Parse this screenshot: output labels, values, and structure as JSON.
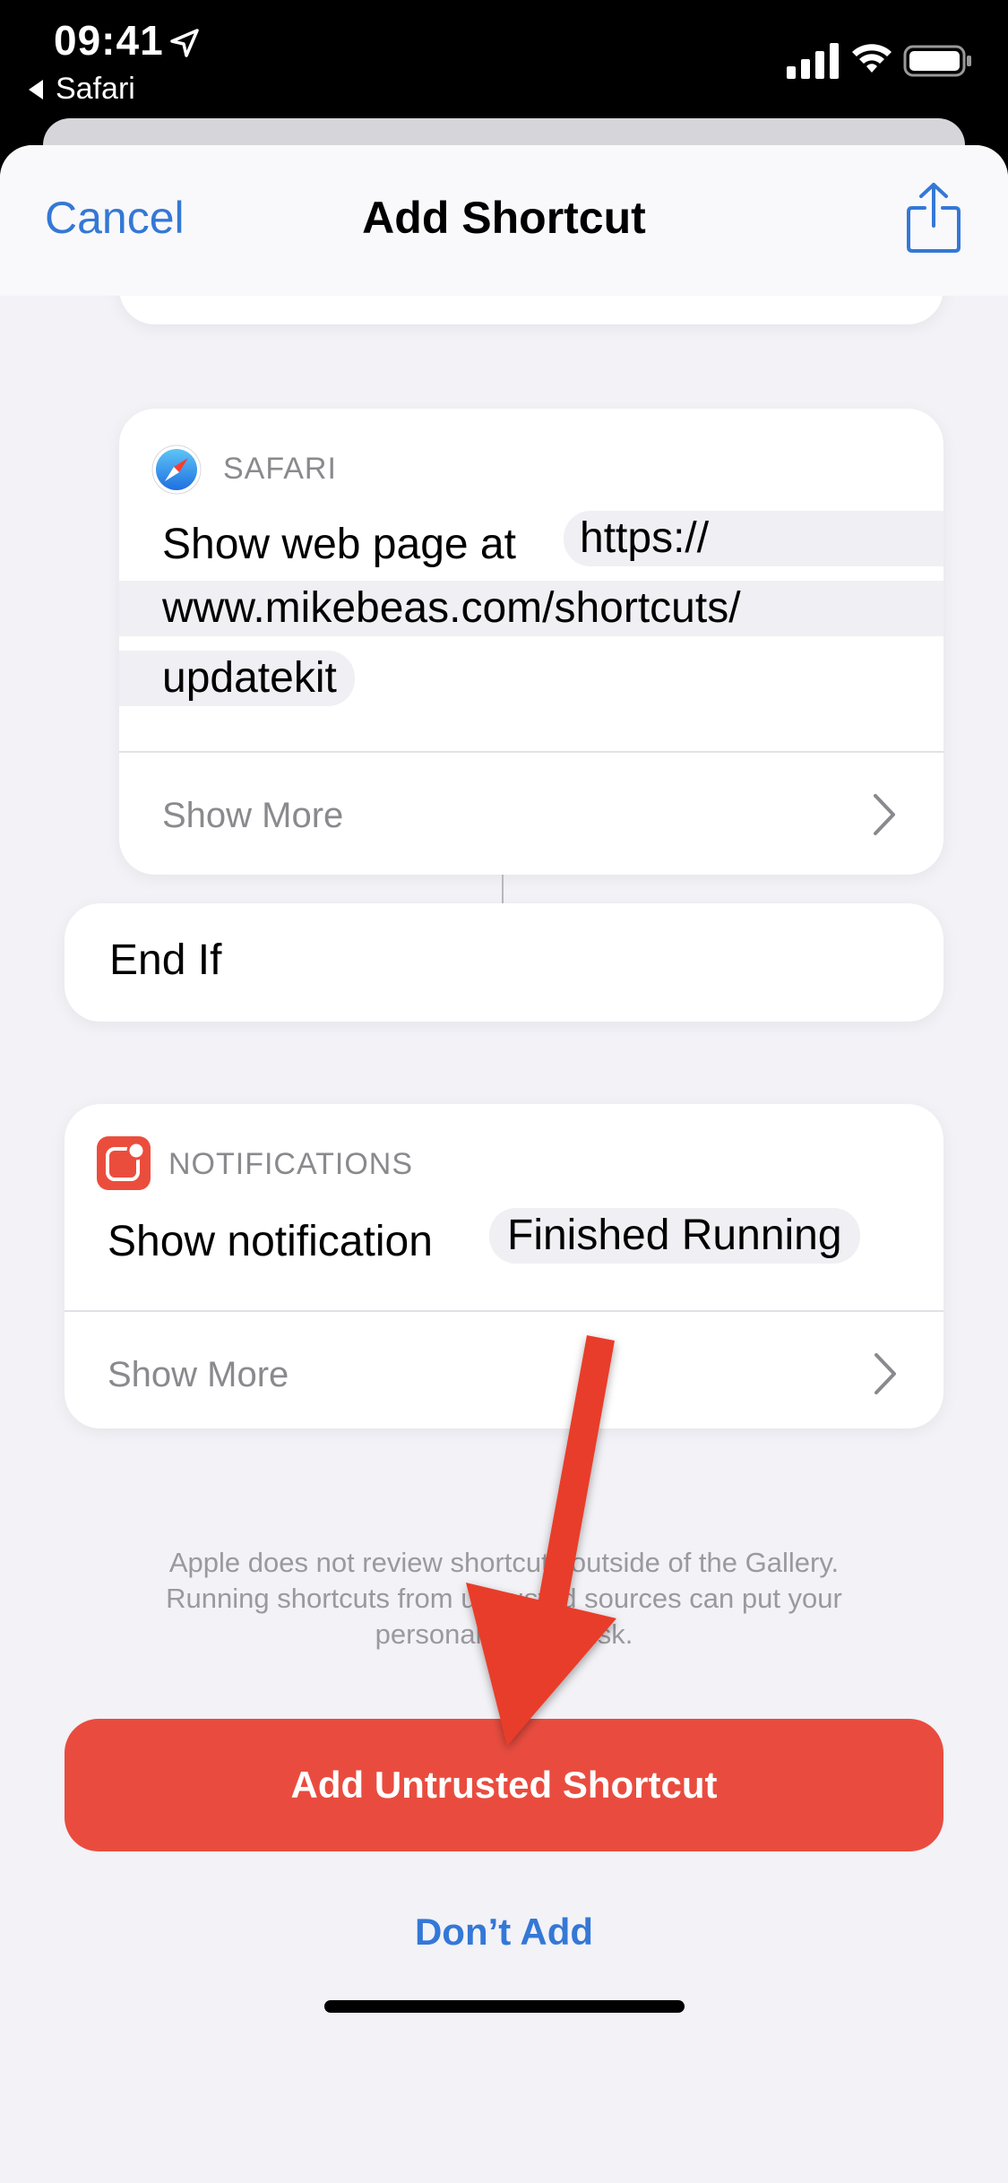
{
  "status_bar": {
    "time": "09:41",
    "back_app": "Safari"
  },
  "navbar": {
    "cancel_label": "Cancel",
    "title": "Add Shortcut"
  },
  "actions": {
    "safari": {
      "app_name": "SAFARI",
      "action_text": "Show web page at",
      "url_line_1": "https://",
      "url_line_2": "www.mikebeas.com/shortcuts/",
      "url_line_3": "updatekit",
      "show_more_label": "Show More"
    },
    "end_if": {
      "label": "End If"
    },
    "notifications": {
      "app_name": "NOTIFICATIONS",
      "action_text": "Show notification",
      "token_text": "Finished Running",
      "show_more_label": "Show More"
    }
  },
  "disclaimer": {
    "line_1": "Apple does not review shortcuts outside of the Gallery.",
    "line_2": "Running shortcuts from untrusted sources can put your",
    "line_3": "personal data at risk."
  },
  "buttons": {
    "add_untrusted_label": "Add Untrusted Shortcut",
    "dont_add_label": "Don’t Add"
  },
  "colors": {
    "accent_blue": "#3478d6",
    "destructive_red": "#e94c3f",
    "annotation_arrow": "#e83d2a",
    "background": "#f2f2f7"
  },
  "icons": {
    "safari": "safari-compass-icon",
    "notifications": "notification-badge-icon",
    "share": "share-icon",
    "chevron": "chevron-right-icon"
  }
}
